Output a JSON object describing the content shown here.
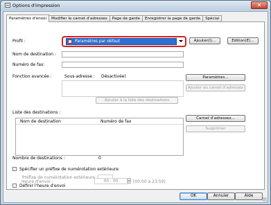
{
  "window": {
    "title": "Options d'impression",
    "close_label": "✕"
  },
  "tabs": [
    "Paramètres d'envoi",
    "Modifier le carnet d'adresses",
    "Page de garde",
    "Enregistrer la page de garde",
    "Spécial"
  ],
  "profile": {
    "label": "Profil :",
    "value": "Paramètres par défaut",
    "add_button": "Ajouter(I)...",
    "edit_button": "Edition(E)..."
  },
  "fields": {
    "dest_name_label": "Nom de destination :",
    "dest_name_value": "",
    "fax_label": "Numéro de fax:",
    "fax_value": ""
  },
  "advanced": {
    "label": "Fonction avancée :",
    "subaddress_label": "Sous-adresse :",
    "subaddress_value": "Désactivée)",
    "params_button": "Paramètres...",
    "add_to_book_button": "Ajouter au carnet d'adresses"
  },
  "list": {
    "add_button": "Ajouter à la liste des destinations",
    "label": "Liste des destinations :",
    "col_name": "Nom de destination",
    "col_fax": "Numéro de fax",
    "address_book_button": "Carnet d'adresses...",
    "delete_button": "Supprimer",
    "count_label": "Nombre de destinations :",
    "count_value": "0"
  },
  "options": {
    "prefix_checkbox": "Spécifier un préfixe de numérotation extérieure",
    "prefix_label": "Préfixe de numérotation extérieure :",
    "prefix_value": "",
    "time_checkbox": "Définir l'heure d'envoi",
    "time_label": "Heure d'envoi :",
    "time_value": "00 : 00",
    "time_range": "[00:00 à 23:59]"
  },
  "footer": {
    "ok": "OK",
    "cancel": "Annuler",
    "help": "Aide"
  }
}
